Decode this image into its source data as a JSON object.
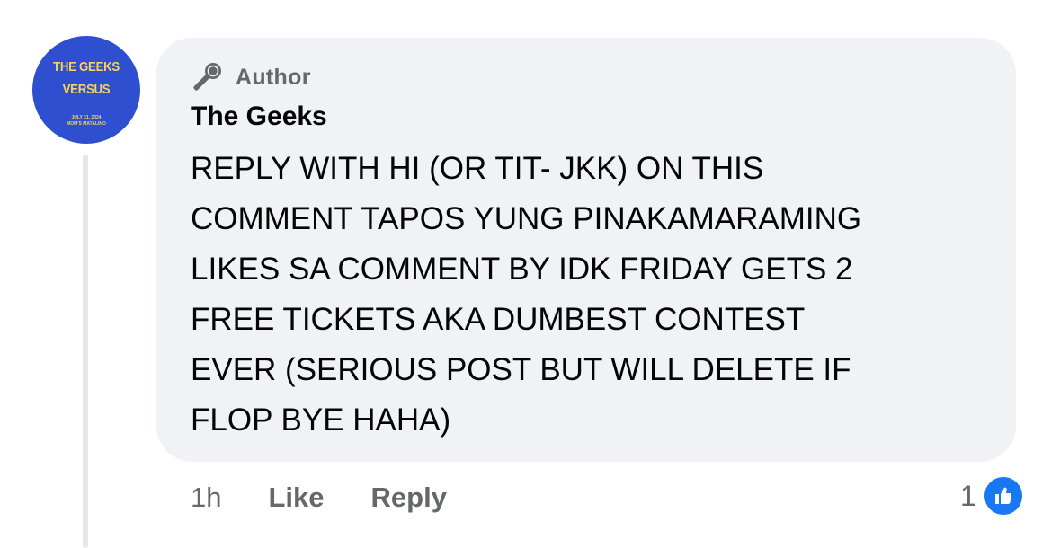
{
  "avatar": {
    "line1": "THE GEEKS",
    "line2": "VERSUS",
    "small1": "JULY 21, 2024",
    "small2": "MOM'S MATALINO",
    "bg_color": "#2d4fd0",
    "text_color": "#f4d35e"
  },
  "comment": {
    "badge_icon": "microphone-icon",
    "badge_label": "Author",
    "author_name": "The Geeks",
    "body": "REPLY WITH HI (OR TIT- JKK) ON THIS\nCOMMENT TAPOS YUNG PINAKAMARAMING\nLIKES SA COMMENT BY IDK FRIDAY GETS 2\nFREE TICKETS AKA DUMBEST CONTEST\nEVER (SERIOUS POST BUT WILL DELETE IF\nFLOP BYE HAHA)"
  },
  "meta": {
    "time": "1h",
    "like_label": "Like",
    "reply_label": "Reply"
  },
  "reactions": {
    "count": "1",
    "icon": "thumbs-up-icon",
    "color": "#1877f2"
  }
}
